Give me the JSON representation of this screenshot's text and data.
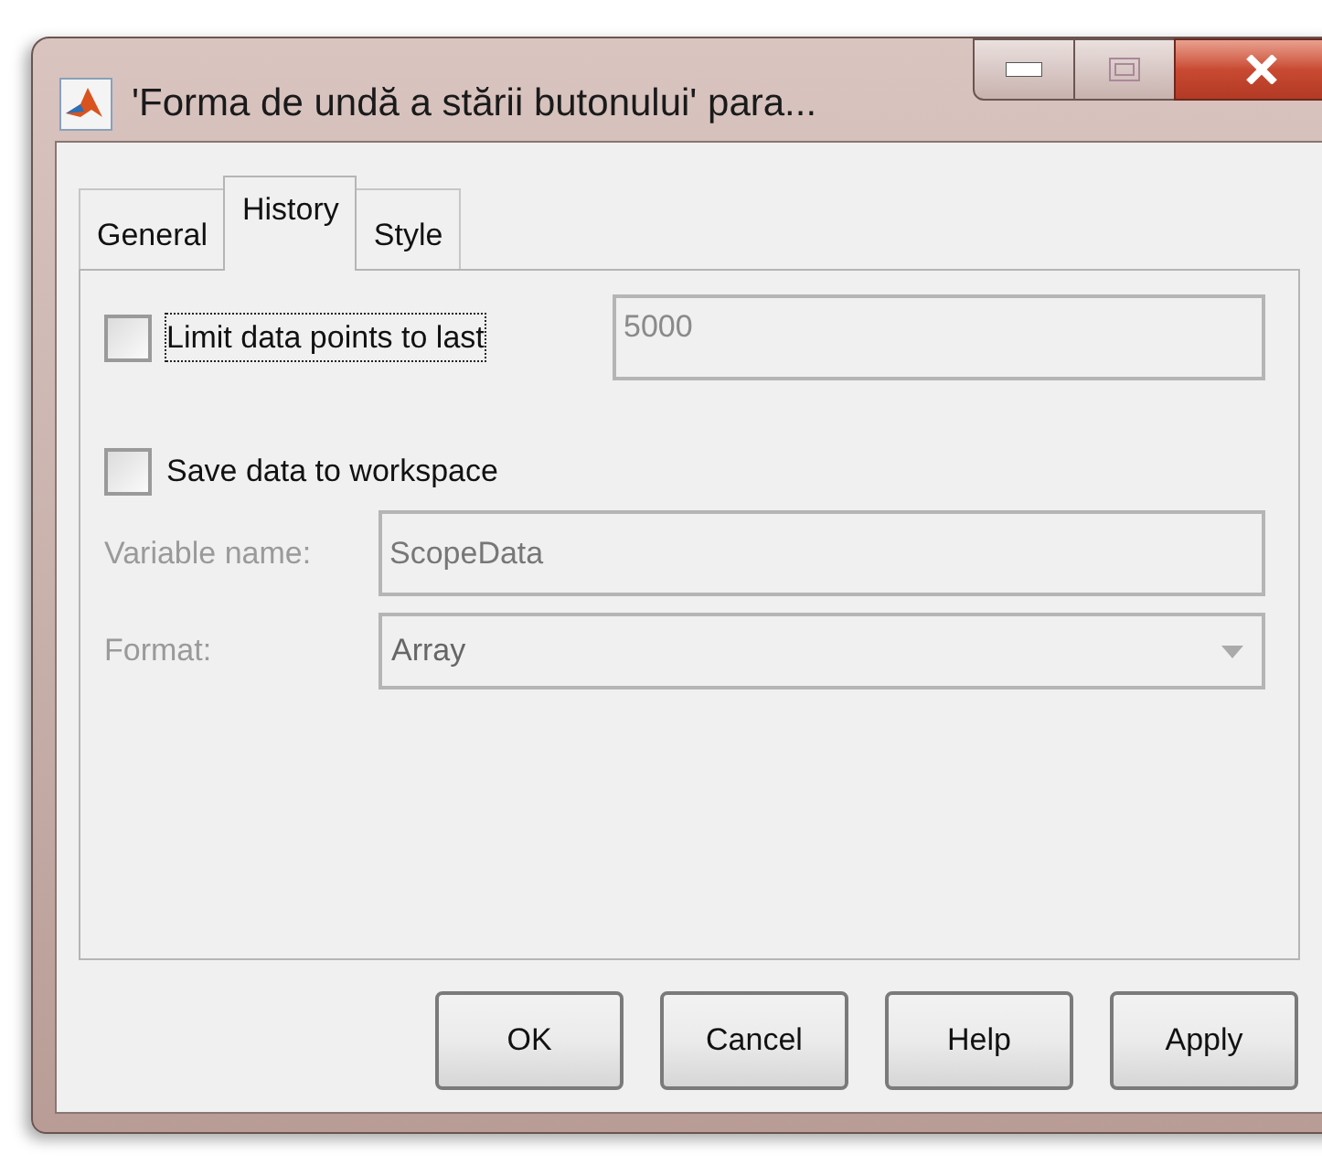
{
  "window": {
    "title": "'Forma de undă a stării butonului' para..."
  },
  "tabs": [
    {
      "label": "General",
      "selected": false
    },
    {
      "label": "History",
      "selected": true
    },
    {
      "label": "Style",
      "selected": false
    }
  ],
  "limit": {
    "label": "Limit data points to last",
    "checked": false,
    "focused": true,
    "value": "5000",
    "disabled": true
  },
  "save": {
    "label": "Save data to workspace",
    "checked": false
  },
  "fields": [
    {
      "kind": "text",
      "label": "Variable name:",
      "value": "ScopeData",
      "disabled": true
    },
    {
      "kind": "dropdown",
      "label": "Format:",
      "value": "Array",
      "disabled": true
    }
  ],
  "buttons": [
    "OK",
    "Cancel",
    "Help",
    "Apply"
  ]
}
